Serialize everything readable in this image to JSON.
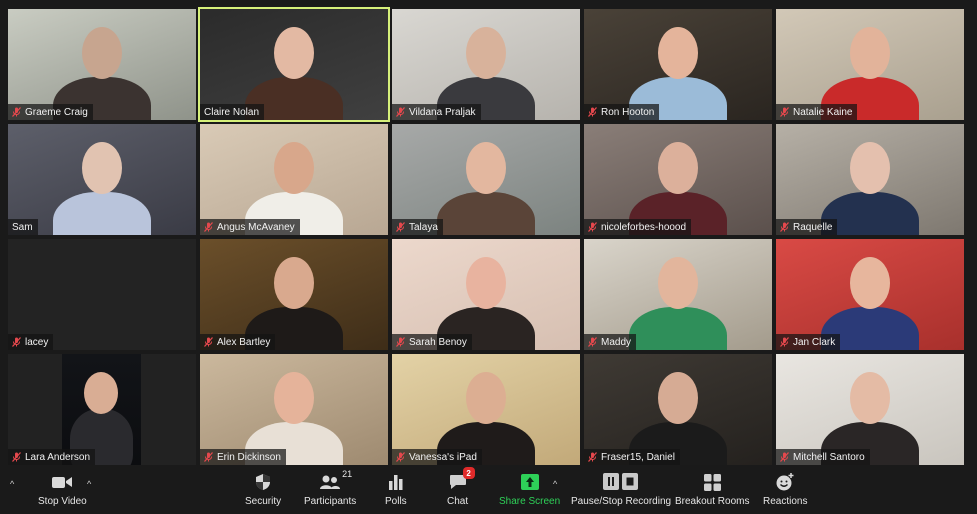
{
  "meeting": {
    "participants": [
      {
        "name": "Graeme Craig",
        "muted": true,
        "active": false,
        "scene": [
          "#c9ccc2",
          "#8f938a",
          "#3b3330",
          "#c7a58f"
        ]
      },
      {
        "name": "Claire Nolan",
        "muted": false,
        "active": true,
        "scene": [
          "#2b2b2b",
          "#404040",
          "#4a2f24",
          "#e3b9a3"
        ]
      },
      {
        "name": "Vildana Praljak",
        "muted": true,
        "active": false,
        "scene": [
          "#d9d7d2",
          "#b6b3ad",
          "#3a3a3e",
          "#d8b29b"
        ]
      },
      {
        "name": "Ron Hooton",
        "muted": true,
        "active": false,
        "scene": [
          "#4a4238",
          "#2a2520",
          "#9bbbd8",
          "#e4b49b"
        ]
      },
      {
        "name": "Natalie Kaine",
        "muted": true,
        "active": false,
        "scene": [
          "#d2c8b7",
          "#a9a08f",
          "#c92a2a",
          "#e2b39a"
        ]
      },
      {
        "name": "Sam",
        "muted": false,
        "active": false,
        "scene": [
          "#5d5f6a",
          "#3a3b45",
          "#b9c4db",
          "#e1c3b1"
        ]
      },
      {
        "name": "Angus McAvaney",
        "muted": true,
        "active": false,
        "scene": [
          "#d9cab6",
          "#b8a793",
          "#f0eee8",
          "#d8a78b"
        ]
      },
      {
        "name": "Talaya",
        "muted": true,
        "active": false,
        "scene": [
          "#a7a9a8",
          "#7c8380",
          "#5a4438",
          "#e3b79f"
        ]
      },
      {
        "name": "nicoleforbes-hoood",
        "muted": true,
        "active": false,
        "scene": [
          "#8a7e78",
          "#5b504c",
          "#5a2228",
          "#dcb09b"
        ]
      },
      {
        "name": "Raquelle",
        "muted": true,
        "active": false,
        "scene": [
          "#b6b0a6",
          "#7e7870",
          "#23314f",
          "#e4c0ae"
        ]
      },
      {
        "name": "lacey",
        "muted": true,
        "active": false,
        "video_off": true,
        "scene": [
          "#232323",
          "#232323",
          "#232323",
          "#232323"
        ]
      },
      {
        "name": "Alex Bartley",
        "muted": true,
        "active": false,
        "scene": [
          "#6b4f2a",
          "#3e2d18",
          "#1e1a18",
          "#d9a98e"
        ]
      },
      {
        "name": "Sarah Benoy",
        "muted": true,
        "active": false,
        "scene": [
          "#ecd8cc",
          "#d6bfb1",
          "#2a2422",
          "#e8b39f"
        ]
      },
      {
        "name": "Maddy",
        "muted": true,
        "active": false,
        "scene": [
          "#d9d4ca",
          "#a39b8c",
          "#2f8f5a",
          "#e2b59c"
        ]
      },
      {
        "name": "Jan Clark",
        "muted": true,
        "active": false,
        "scene": [
          "#d94a45",
          "#a8302c",
          "#2b3a78",
          "#e7b69d"
        ]
      },
      {
        "name": "Lara Anderson",
        "muted": true,
        "active": false,
        "portrait": true,
        "scene": [
          "#121418",
          "#0c0d10",
          "#2a2a2e",
          "#d9ad94"
        ]
      },
      {
        "name": "Erin Dickinson",
        "muted": true,
        "active": false,
        "scene": [
          "#cbb89d",
          "#9e8a70",
          "#e8e0d6",
          "#e5b39a"
        ]
      },
      {
        "name": "Vanessa's iPad",
        "muted": true,
        "active": false,
        "scene": [
          "#e3d2a6",
          "#c2a979",
          "#1f1b1a",
          "#dcae92"
        ]
      },
      {
        "name": "Fraser15, Daniel",
        "muted": true,
        "active": false,
        "scene": [
          "#3f3a34",
          "#24211e",
          "#1b1b1b",
          "#d6ab94"
        ]
      },
      {
        "name": "Mitchell Santoro",
        "muted": true,
        "active": false,
        "scene": [
          "#e9e6e1",
          "#c9c5be",
          "#2a2626",
          "#e4bba5"
        ]
      }
    ]
  },
  "toolbar": {
    "stop_video": {
      "label": "Stop Video",
      "icon": "video-camera-icon"
    },
    "security": {
      "label": "Security",
      "icon": "shield-icon"
    },
    "participants": {
      "label": "Participants",
      "icon": "people-icon",
      "count": "21"
    },
    "polls": {
      "label": "Polls",
      "icon": "bar-chart-icon"
    },
    "chat": {
      "label": "Chat",
      "icon": "chat-bubble-icon",
      "badge": "2"
    },
    "share_screen": {
      "label": "Share Screen",
      "icon": "share-arrow-icon",
      "color": "#2ed158"
    },
    "recording": {
      "label": "Pause/Stop Recording",
      "icon": "pause-stop-icon"
    },
    "breakout": {
      "label": "Breakout Rooms",
      "icon": "grid-icon"
    },
    "reactions": {
      "label": "Reactions",
      "icon": "smiley-plus-icon"
    }
  },
  "colors": {
    "active_speaker": "#d6f07a",
    "mute": "#e5484d",
    "background": "#1a1a1a",
    "badge": "#e02a2a"
  }
}
